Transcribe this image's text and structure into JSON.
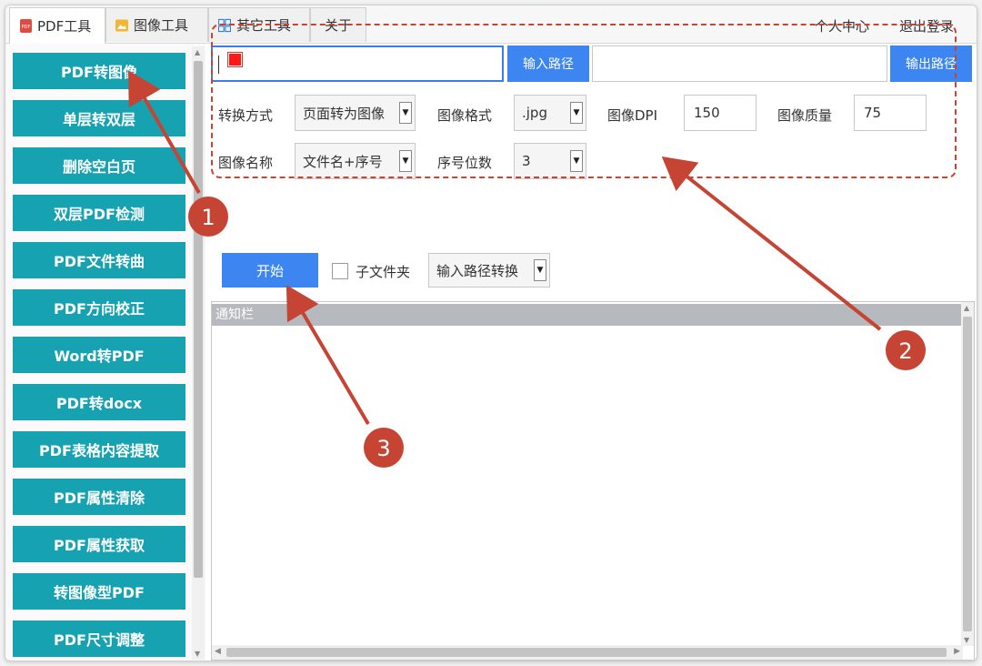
{
  "tabs": [
    {
      "label": "PDF工具",
      "icon": "pdf-icon"
    },
    {
      "label": "图像工具",
      "icon": "image-icon"
    },
    {
      "label": "其它工具",
      "icon": "grid-icon"
    },
    {
      "label": "关于"
    }
  ],
  "top_links": {
    "personal_center": "个人中心",
    "logout": "退出登录"
  },
  "sidebar": {
    "items": [
      "PDF转图像",
      "单层转双层",
      "删除空白页",
      "双层PDF检测",
      "PDF文件转曲",
      "PDF方向校正",
      "Word转PDF",
      "PDF转docx",
      "PDF表格内容提取",
      "PDF属性清除",
      "PDF属性获取",
      "转图像型PDF",
      "PDF尺寸调整"
    ]
  },
  "io": {
    "input_path_value": "",
    "input_path_button": "输入路径",
    "output_path_value": "",
    "output_path_button": "输出路径"
  },
  "settings": {
    "conversion_method_label": "转换方式",
    "conversion_method_value": "页面转为图像",
    "image_format_label": "图像格式",
    "image_format_value": ".jpg",
    "image_dpi_label": "图像DPI",
    "image_dpi_value": "150",
    "image_quality_label": "图像质量",
    "image_quality_value": "75",
    "image_name_label": "图像名称",
    "image_name_value": "文件名+序号",
    "sequence_digits_label": "序号位数",
    "sequence_digits_value": "3"
  },
  "actions": {
    "start_button": "开始",
    "subfolder_label": "子文件夹",
    "subfolder_checked": false,
    "mode_value": "输入路径转换"
  },
  "notice": {
    "title": "通知栏"
  },
  "annotations": [
    "1",
    "2",
    "3"
  ],
  "colors": {
    "sidebar_button": "#17a2b1",
    "primary_button": "#3d85f0",
    "annotation": "#c64434"
  }
}
